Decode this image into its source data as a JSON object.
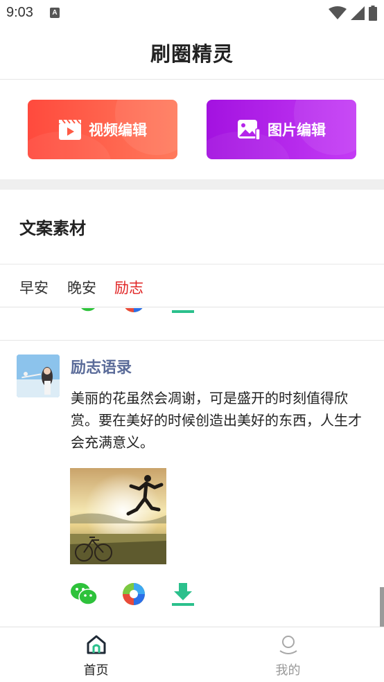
{
  "status_bar": {
    "time": "9:03",
    "notification_glyph": "A"
  },
  "app_bar": {
    "title": "刷圈精灵"
  },
  "editors": {
    "video_label": "视频编辑",
    "image_label": "图片编辑",
    "video_color": "#ff5a44",
    "image_color": "#b424ea"
  },
  "section": {
    "title": "文案素材"
  },
  "tabs": [
    {
      "label": "早安",
      "active": false
    },
    {
      "label": "晚安",
      "active": false
    },
    {
      "label": "励志",
      "active": true
    }
  ],
  "accent_active_tab": "#e02424",
  "post": {
    "title": "励志语录",
    "text": "美丽的花虽然会凋谢，可是盛开的时刻值得欣赏。要在美好的时候创造出美好的东西，人生才会充满意义。",
    "actions": [
      "wechat-icon",
      "moments-icon",
      "download-icon"
    ]
  },
  "bottom_nav": [
    {
      "label": "首页",
      "icon": "home-icon",
      "active": true
    },
    {
      "label": "我的",
      "icon": "profile-icon",
      "active": false
    }
  ]
}
